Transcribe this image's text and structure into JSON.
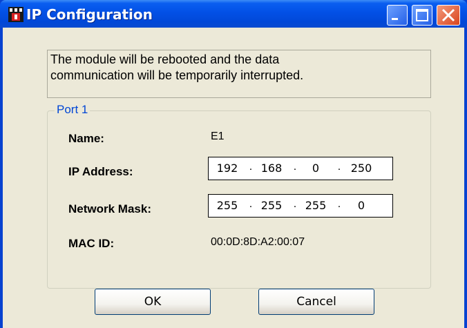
{
  "window": {
    "title": "IP Configuration"
  },
  "message": {
    "line1": "The module will be rebooted and the data",
    "line2": "communication will be temporarily interrupted."
  },
  "port": {
    "legend": "Port 1",
    "name_label": "Name:",
    "name_value": "E1",
    "ip_label": "IP Address:",
    "ip_octets": [
      "192",
      "168",
      "0",
      "250"
    ],
    "mask_label": "Network Mask:",
    "mask_octets": [
      "255",
      "255",
      "255",
      "0"
    ],
    "mac_label": "MAC ID:",
    "mac_value": "00:0D:8D:A2:00:07"
  },
  "buttons": {
    "ok_label": "OK",
    "cancel_label": "Cancel"
  },
  "colors": {
    "titlebar": "#0250e6",
    "legend": "#0046d5",
    "close_button": "#d9451e"
  }
}
